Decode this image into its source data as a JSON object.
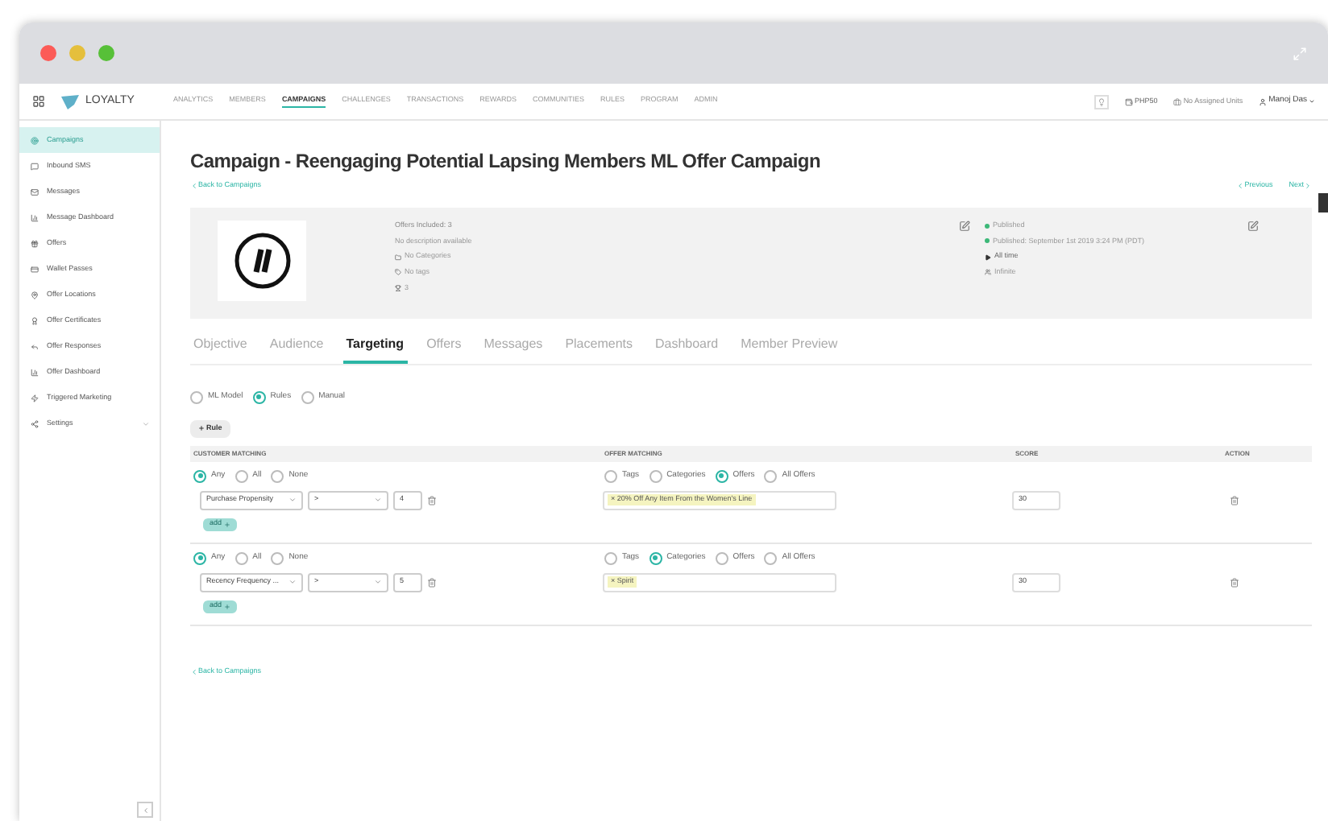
{
  "nav": {
    "brand": "LOYALTY",
    "items": [
      {
        "label": "ANALYTICS",
        "selected": false
      },
      {
        "label": "MEMBERS",
        "selected": false
      },
      {
        "label": "CAMPAIGNS",
        "selected": true
      },
      {
        "label": "CHALLENGES",
        "selected": false
      },
      {
        "label": "TRANSACTIONS",
        "selected": false
      },
      {
        "label": "REWARDS",
        "selected": false
      },
      {
        "label": "COMMUNITIES",
        "selected": false
      },
      {
        "label": "RULES",
        "selected": false
      },
      {
        "label": "PROGRAM",
        "selected": false
      },
      {
        "label": "ADMIN",
        "selected": false
      }
    ],
    "currency": "PHP50",
    "units": "No Assigned Units",
    "user": "Manoj Das"
  },
  "sidebar": {
    "items": [
      {
        "label": "Campaigns",
        "selected": true
      },
      {
        "label": "Inbound SMS",
        "selected": false
      },
      {
        "label": "Messages",
        "selected": false
      },
      {
        "label": "Message Dashboard",
        "selected": false
      },
      {
        "label": "Offers",
        "selected": false
      },
      {
        "label": "Wallet Passes",
        "selected": false
      },
      {
        "label": "Offer Locations",
        "selected": false
      },
      {
        "label": "Offer Certificates",
        "selected": false
      },
      {
        "label": "Offer Responses",
        "selected": false
      },
      {
        "label": "Offer Dashboard",
        "selected": false
      },
      {
        "label": "Triggered Marketing",
        "selected": false
      },
      {
        "label": "Settings",
        "selected": false
      }
    ]
  },
  "page": {
    "title": "Campaign - Reengaging Potential Lapsing Members ML Offer Campaign",
    "back": "Back to Campaigns",
    "previous": "Previous",
    "next": "Next"
  },
  "summary": {
    "offers": "Offers Included: 3",
    "description": "No description available",
    "categories": "No Categories",
    "tags": "No tags",
    "count": "3",
    "status": "Published",
    "published": "Published: September 1st 2019 3:24 PM (PDT)",
    "period": "All time",
    "audience": "Infinite"
  },
  "tabs": [
    {
      "label": "Objective",
      "selected": false
    },
    {
      "label": "Audience",
      "selected": false
    },
    {
      "label": "Targeting",
      "selected": true
    },
    {
      "label": "Offers",
      "selected": false
    },
    {
      "label": "Messages",
      "selected": false
    },
    {
      "label": "Placements",
      "selected": false
    },
    {
      "label": "Dashboard",
      "selected": false
    },
    {
      "label": "Member Preview",
      "selected": false
    }
  ],
  "modes": [
    {
      "label": "ML Model",
      "selected": false
    },
    {
      "label": "Rules",
      "selected": true
    },
    {
      "label": "Manual",
      "selected": false
    }
  ],
  "add_rule": "Rule",
  "columns": [
    "CUSTOMER MATCHING",
    "OFFER MATCHING",
    "SCORE",
    "ACTION"
  ],
  "rules": [
    {
      "match": [
        {
          "label": "Any",
          "selected": true
        },
        {
          "label": "All",
          "selected": false
        },
        {
          "label": "None",
          "selected": false
        }
      ],
      "attribute": "Purchase Propensity",
      "operator": ">",
      "value": "4",
      "offer_match": [
        {
          "label": "Tags",
          "selected": false
        },
        {
          "label": "Categories",
          "selected": false
        },
        {
          "label": "Offers",
          "selected": true
        },
        {
          "label": "All Offers",
          "selected": false
        }
      ],
      "chip_remove": "×",
      "chip": "20% Off Any Item From the Women's Line",
      "score": "30",
      "add": "add"
    },
    {
      "match": [
        {
          "label": "Any",
          "selected": true
        },
        {
          "label": "All",
          "selected": false
        },
        {
          "label": "None",
          "selected": false
        }
      ],
      "attribute": "Recency Frequency ...",
      "operator": ">",
      "value": "5",
      "offer_match": [
        {
          "label": "Tags",
          "selected": false
        },
        {
          "label": "Categories",
          "selected": true
        },
        {
          "label": "Offers",
          "selected": false
        },
        {
          "label": "All Offers",
          "selected": false
        }
      ],
      "chip_remove": "×",
      "chip": "Spirit",
      "score": "30",
      "add": "add"
    }
  ],
  "footer_back": "Back to Campaigns"
}
